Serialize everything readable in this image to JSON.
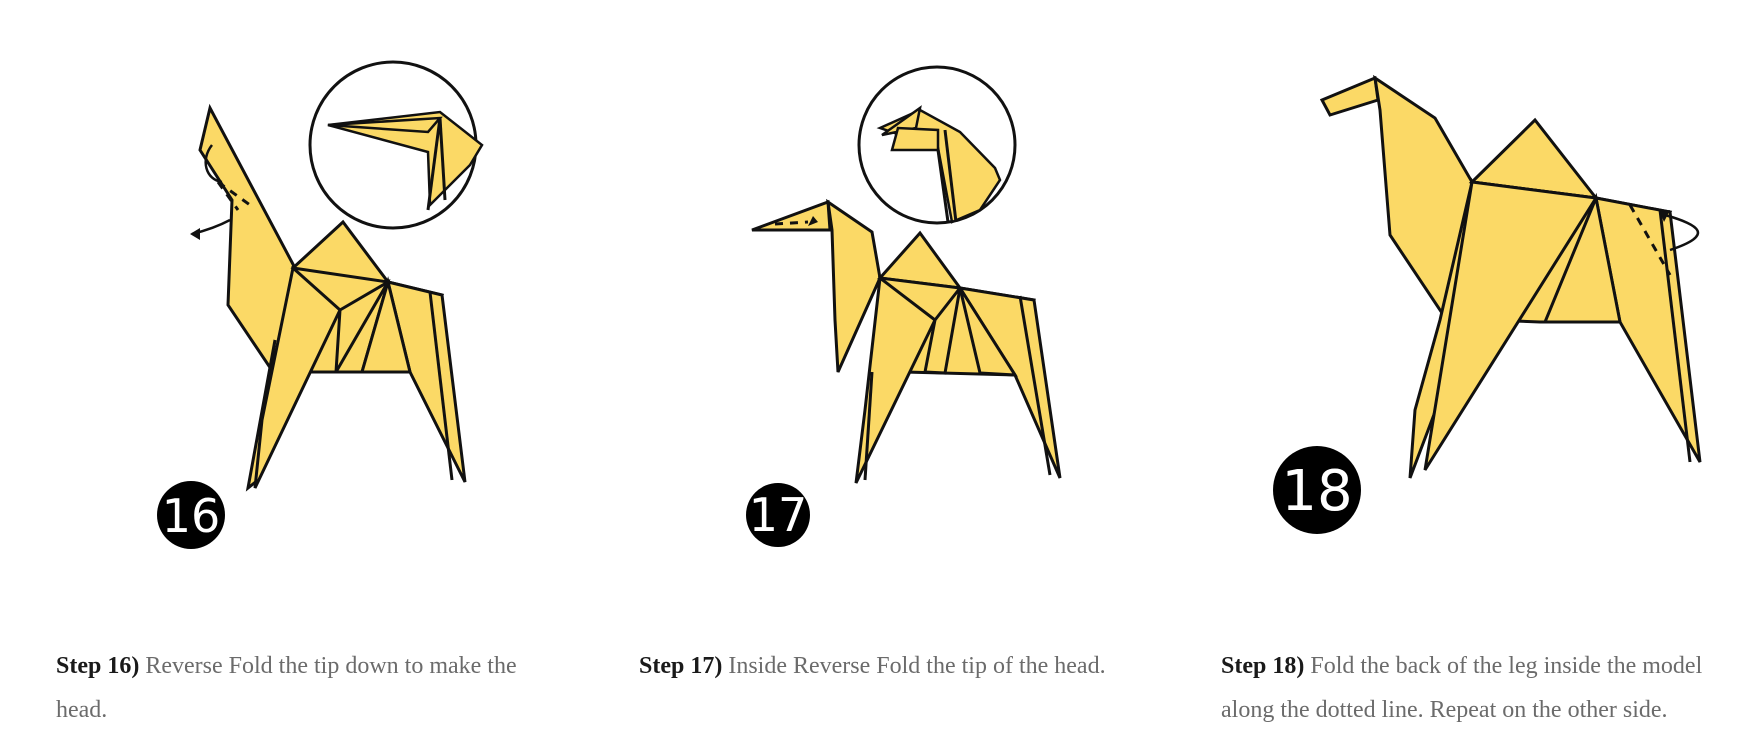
{
  "steps": [
    {
      "number": "16",
      "label": "Step 16)",
      "text": " Reverse Fold the tip down to make the head."
    },
    {
      "number": "17",
      "label": "Step 17)",
      "text": " Inside Reverse Fold the tip of the head."
    },
    {
      "number": "18",
      "label": "Step 18)",
      "text": " Fold the back of the leg inside the model along the dotted line. Repeat on the other side."
    }
  ],
  "colors": {
    "paper": "#fbd966",
    "outline": "#111111",
    "badge": "#000000",
    "caption_text": "#6b6b6b",
    "caption_label": "#1a1a1a"
  }
}
